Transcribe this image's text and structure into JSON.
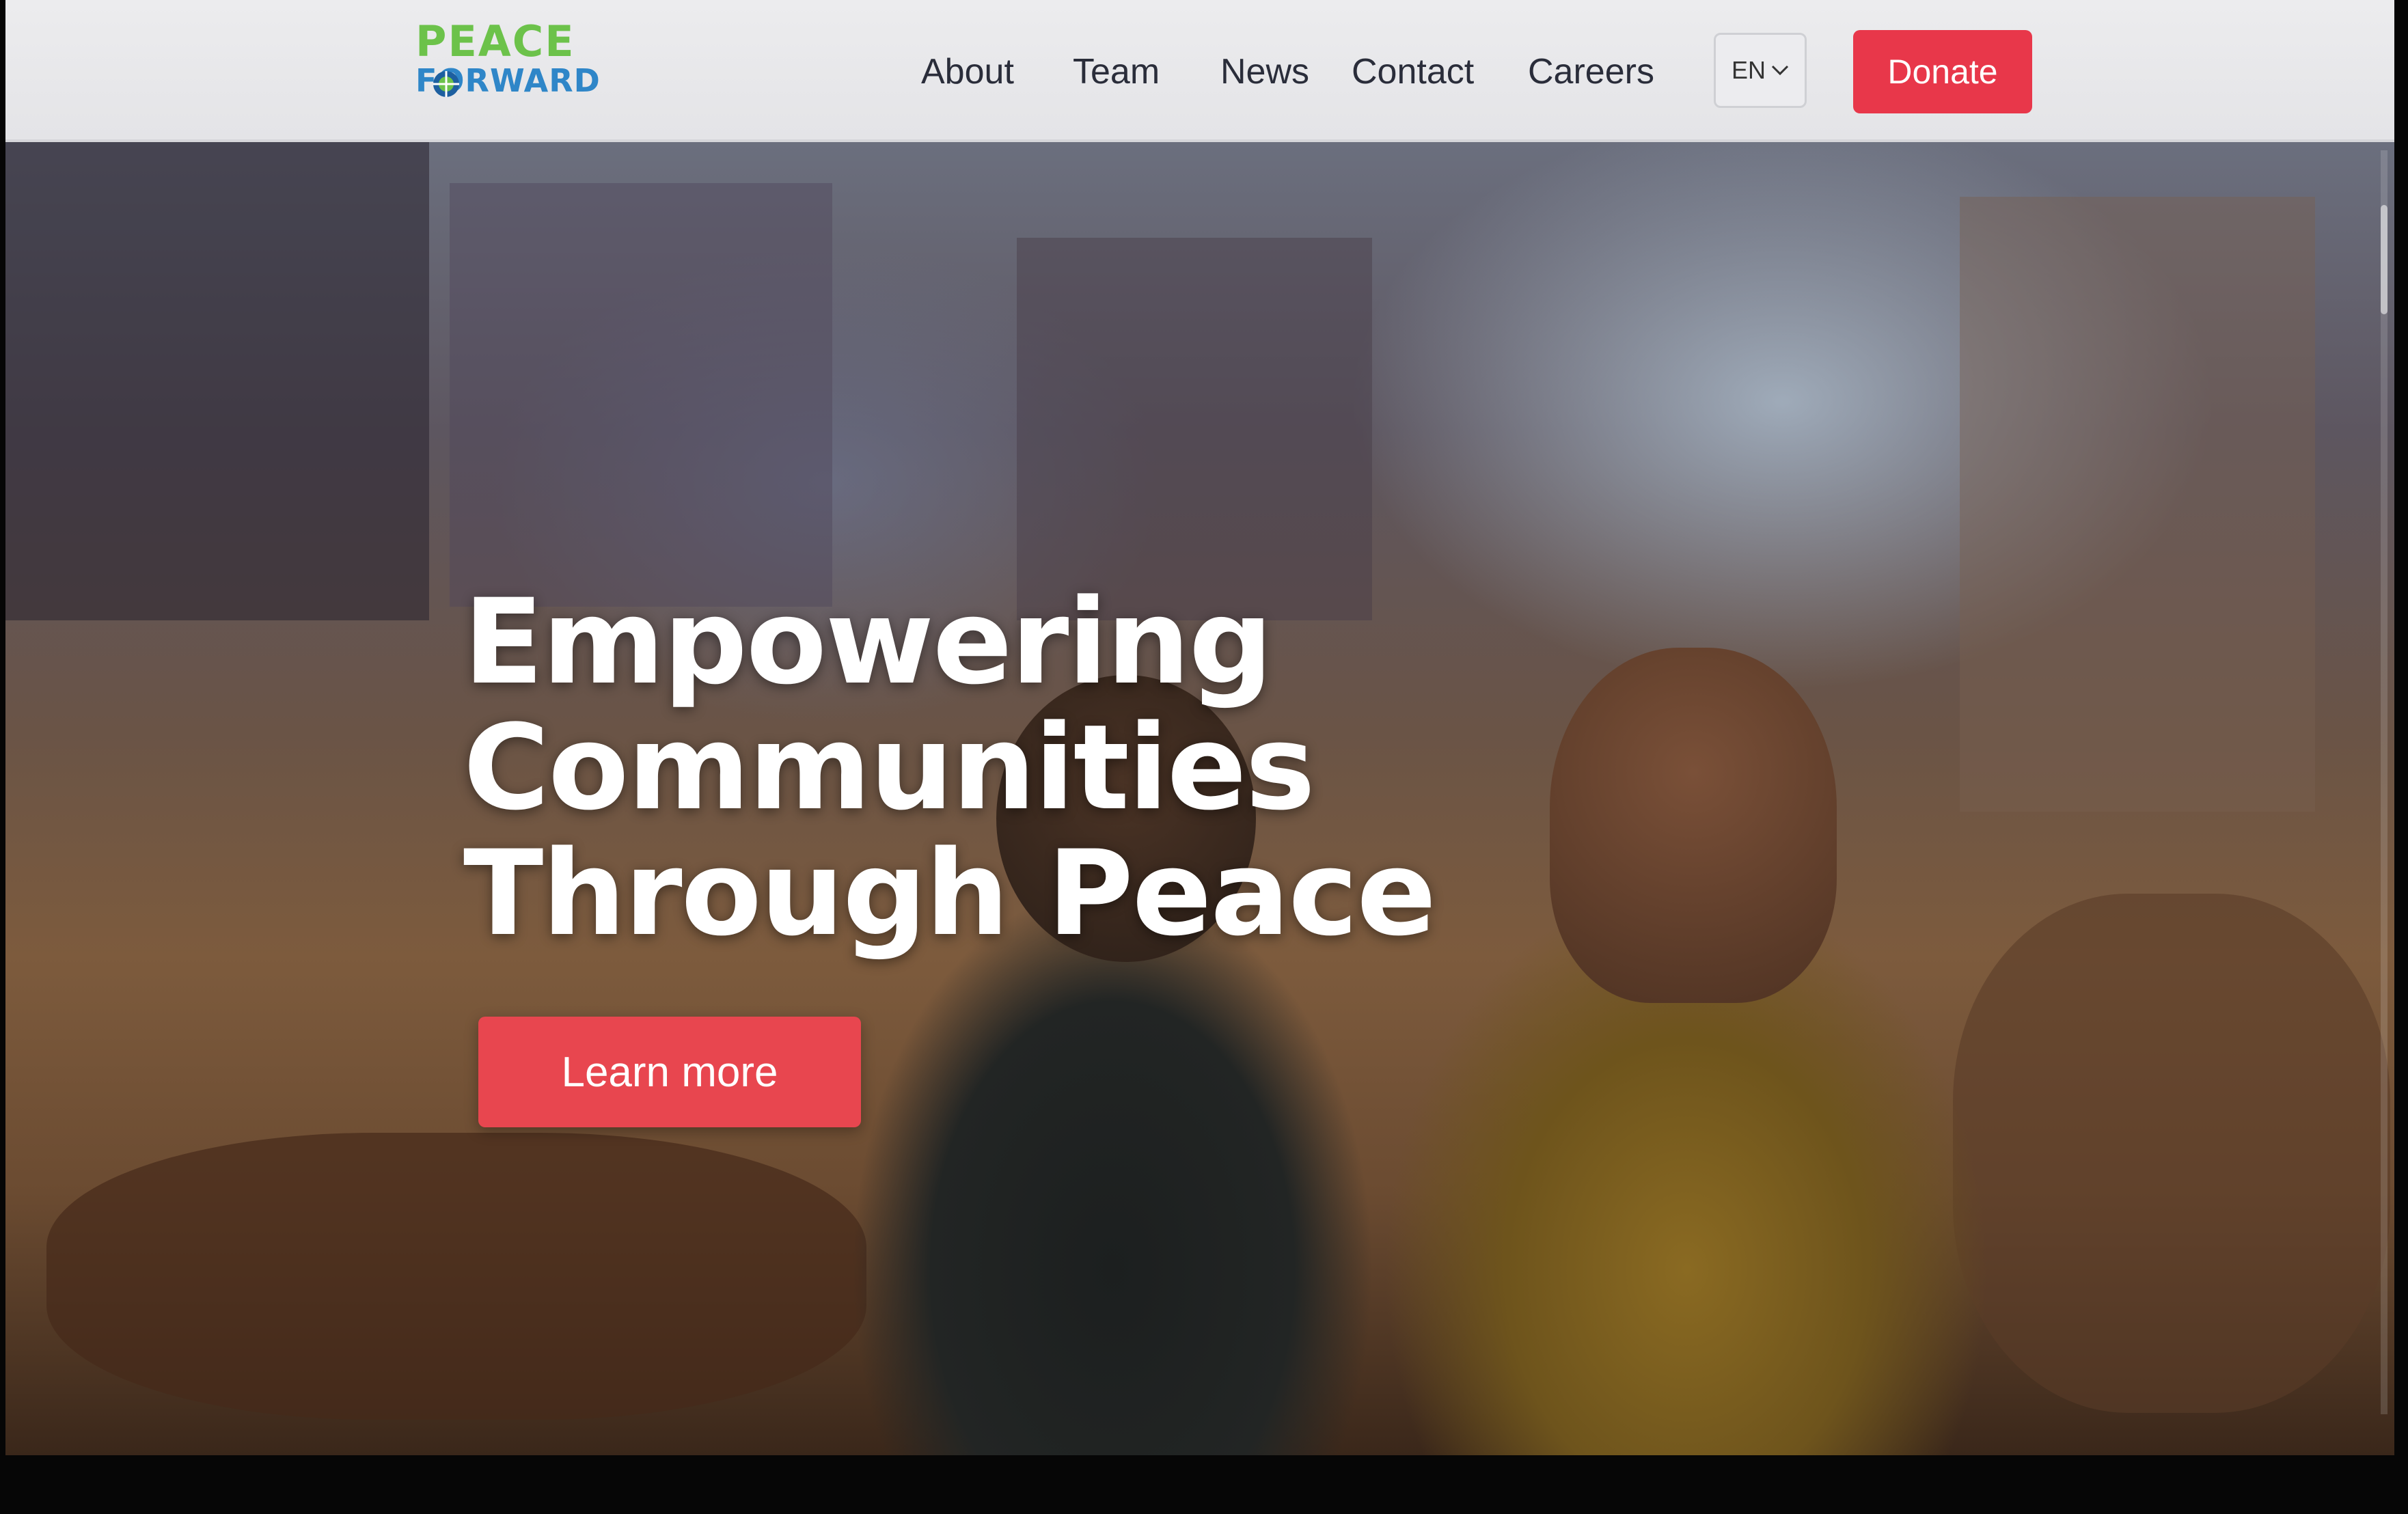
{
  "header": {
    "logo": {
      "line1": "PEACE",
      "line2": "FORWARD"
    },
    "nav": [
      {
        "label": "About"
      },
      {
        "label": "Team"
      },
      {
        "label": "News"
      },
      {
        "label": "Contact"
      },
      {
        "label": "Careers"
      }
    ],
    "language": {
      "selected": "EN",
      "icon": "chevron-down-icon"
    },
    "donate_label": "Donate"
  },
  "hero": {
    "title_lines": [
      "Empowering",
      "Communities",
      "Through Peace"
    ],
    "cta_label": "Learn more"
  },
  "colors": {
    "accent": "#e8374a",
    "logo_green": "#6cc24a",
    "logo_blue": "#2f86c8",
    "nav_text": "#2a2d3a"
  }
}
